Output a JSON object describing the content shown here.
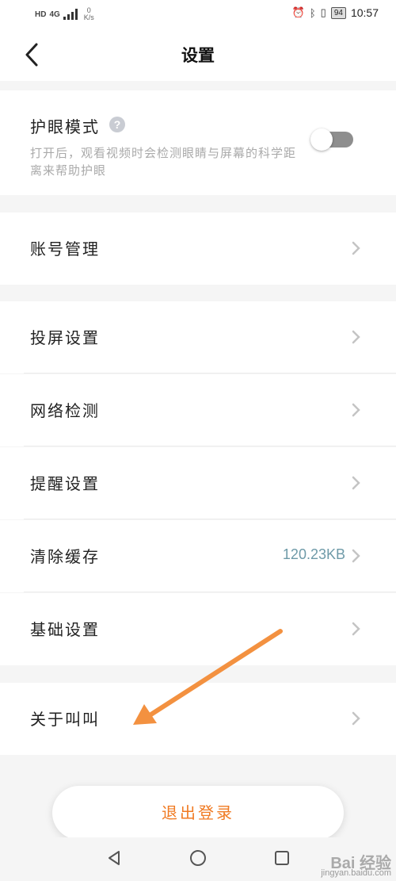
{
  "status_bar": {
    "hd": "HD",
    "network": "4G",
    "speed_value": "0",
    "speed_unit": "K/s",
    "battery": "94",
    "time": "10:57"
  },
  "header": {
    "title": "设置"
  },
  "eye_protection": {
    "label": "护眼模式",
    "help": "?",
    "description": "打开后，观看视频时会检测眼睛与屏幕的科学距离来帮助护眼",
    "enabled": false
  },
  "rows": [
    {
      "label": "账号管理"
    },
    {
      "label": "投屏设置"
    },
    {
      "label": "网络检测"
    },
    {
      "label": "提醒设置"
    },
    {
      "label": "清除缓存",
      "value": "120.23KB"
    },
    {
      "label": "基础设置"
    },
    {
      "label": "关于叫叫"
    }
  ],
  "logout": {
    "label": "退出登录"
  },
  "watermark": {
    "brand": "Bai 经验",
    "url": "jingyan.baidu.com"
  },
  "colors": {
    "accent": "#f07a22",
    "cache_value": "#6e9aa8",
    "annotation_arrow": "#f39140"
  }
}
